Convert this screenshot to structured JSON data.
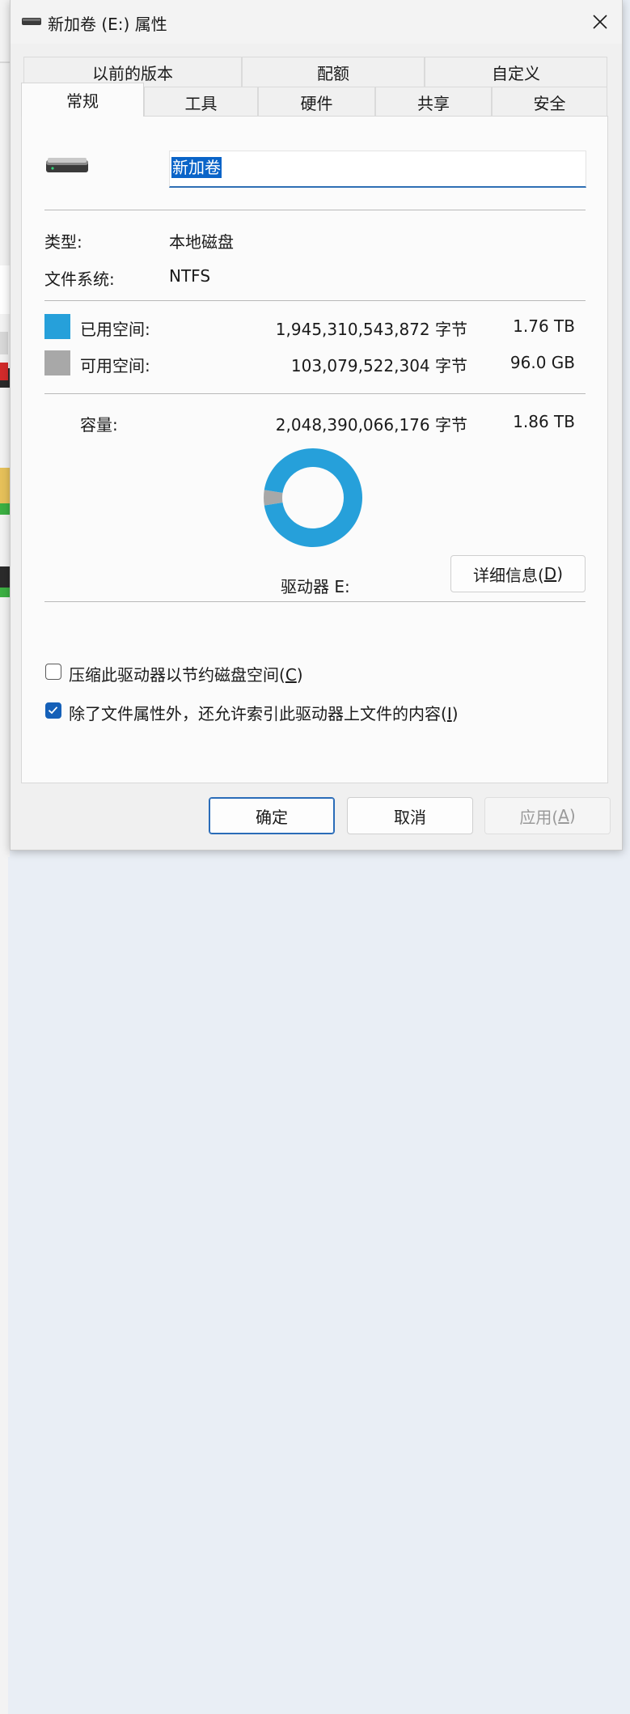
{
  "window": {
    "title": "新加卷 (E:) 属性"
  },
  "tabs_row1": [
    {
      "label": "以前的版本"
    },
    {
      "label": "配额"
    },
    {
      "label": "自定义"
    }
  ],
  "tabs_row2": [
    {
      "label": "常规",
      "active": true
    },
    {
      "label": "工具"
    },
    {
      "label": "硬件"
    },
    {
      "label": "共享"
    },
    {
      "label": "安全"
    }
  ],
  "general": {
    "volume_name": "新加卷",
    "type_label": "类型:",
    "type_value": "本地磁盘",
    "fs_label": "文件系统:",
    "fs_value": "NTFS",
    "used_label": "已用空间:",
    "used_bytes": "1,945,310,543,872 字节",
    "used_size": "1.76 TB",
    "free_label": "可用空间:",
    "free_bytes": "103,079,522,304 字节",
    "free_size": "96.0 GB",
    "capacity_label": "容量:",
    "capacity_bytes": "2,048,390,066,176 字节",
    "capacity_size": "1.86 TB",
    "drive_label": "驱动器 E:",
    "details_button_prefix": "详细信息(",
    "details_button_key": "D",
    "details_button_suffix": ")",
    "compress_prefix": "压缩此驱动器以节约磁盘空间(",
    "compress_key": "C",
    "compress_suffix": ")",
    "compress_checked": false,
    "index_prefix": "除了文件属性外，还允许索引此驱动器上文件的内容(",
    "index_key": "I",
    "index_suffix": ")",
    "index_checked": true
  },
  "usage": {
    "used_fraction": 0.9497,
    "used_color": "#26a0da",
    "free_color": "#a8a8a8"
  },
  "footer": {
    "ok_label": "确定",
    "cancel_label": "取消",
    "apply_prefix": "应用(",
    "apply_key": "A",
    "apply_suffix": ")"
  }
}
